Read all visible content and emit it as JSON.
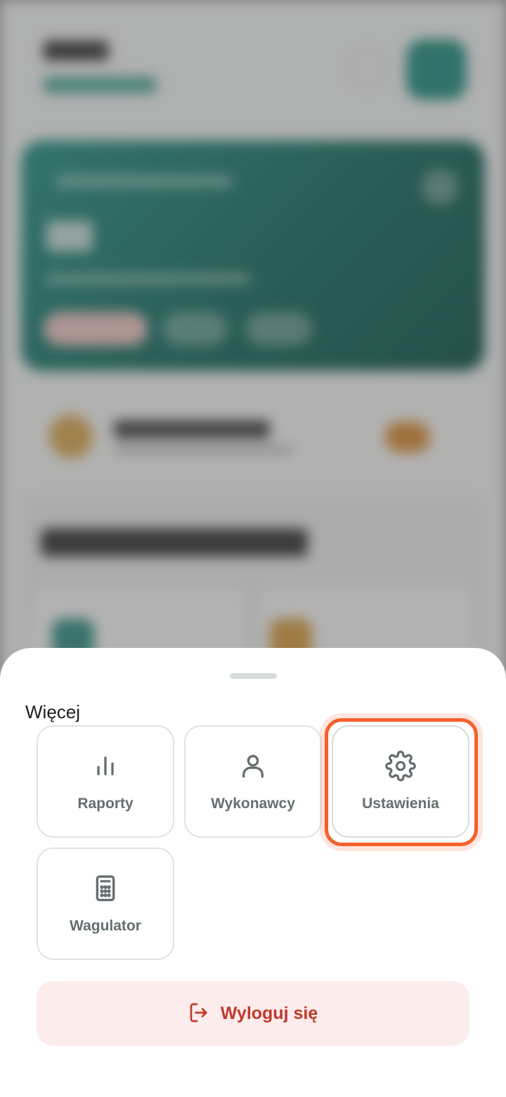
{
  "sheet": {
    "title": "Więcej",
    "items": [
      {
        "label": "Raporty",
        "icon": "bar-chart-icon"
      },
      {
        "label": "Wykonawcy",
        "icon": "user-icon"
      },
      {
        "label": "Ustawienia",
        "icon": "gear-icon",
        "highlighted": true
      },
      {
        "label": "Wagulator",
        "icon": "calculator-icon"
      }
    ],
    "logout": {
      "label": "Wyloguj się",
      "icon": "logout-icon"
    }
  },
  "colors": {
    "accent": "#1a8c7c",
    "highlight": "#f7602a",
    "logout_bg": "#fdecec",
    "logout_text": "#c0392b",
    "tile_label": "#656e70"
  }
}
